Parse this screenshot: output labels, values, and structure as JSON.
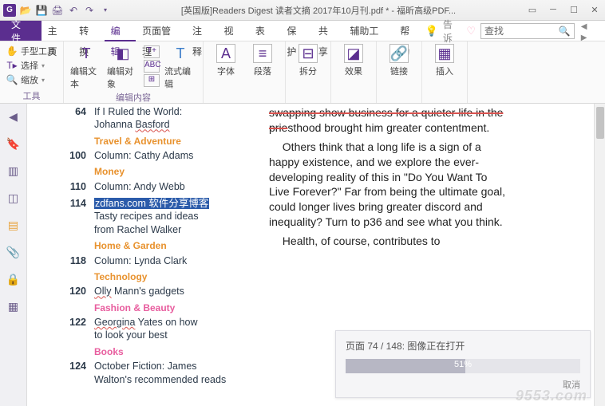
{
  "titlebar": {
    "title": "[英国版]Readers Digest 读者文摘 2017年10月刊.pdf * - 福昕高级PDF..."
  },
  "menu": {
    "file": "文件",
    "tabs": [
      "主页",
      "转换",
      "编辑",
      "页面管理",
      "注释",
      "视图",
      "表单",
      "保护",
      "共享",
      "辅助工具",
      "帮助"
    ],
    "active_index": 2,
    "tell": "告诉",
    "search_placeholder": "查找"
  },
  "ribbon": {
    "tools_group": "工具",
    "hand": "手型工具",
    "select": "选择",
    "zoom": "缩放",
    "edit_content_group": "编辑内容",
    "edit_text": "编辑文本",
    "edit_object": "编辑对象",
    "flow_edit": "流式编辑",
    "font_group": "字体",
    "font_label": "字体",
    "para_label": "段落",
    "split_label": "拆分",
    "effect_label": "效果",
    "link_label": "链接",
    "insert_label": "插入"
  },
  "toc": [
    {
      "pg": "64",
      "lines": [
        "If I Ruled the World:",
        "Johanna <wavy>Basford</wavy>"
      ]
    },
    {
      "section": "Travel & Adventure"
    },
    {
      "pg": "100",
      "lines": [
        "Column: Cathy Adams"
      ]
    },
    {
      "section": "Money"
    },
    {
      "pg": "110",
      "lines": [
        "Column: Andy Webb"
      ]
    },
    {
      "pg": "114",
      "lines": [
        "<hl>zdfans.com 软件分享博客</hl>",
        "Tasty recipes and ideas",
        "from Rachel Walker"
      ]
    },
    {
      "section": "Home & Garden"
    },
    {
      "pg": "118",
      "lines": [
        "Column: Lynda Clark"
      ]
    },
    {
      "section": "Technology"
    },
    {
      "pg": "120",
      "lines": [
        "<wavy>Olly</wavy> Mann's gadgets"
      ]
    },
    {
      "section_pink": "Fashion & Beauty"
    },
    {
      "pg": "122",
      "lines": [
        "<wavy>Georgina</wavy> Yates on how",
        "to look your best"
      ]
    },
    {
      "section_pink": "Books"
    },
    {
      "pg": "124",
      "lines": [
        "October Fiction: James",
        "Walton's recommended reads"
      ]
    }
  ],
  "article": {
    "p1a": "swapping show business for a quieter life in the prie",
    "p1b": "sthood brought him greater contentment.",
    "p2": "Others think that a long life is a sign of a happy existence, and we explore the ever-developing reality of this in \"Do You Want To Live Forever?\" Far from being the ultimate goal, could longer lives bring greater discord and inequality? Turn to p36 and see what you think.",
    "p3": "Health, of course, contributes to"
  },
  "progress": {
    "status": "页面 74 / 148: 图像正在打开",
    "percent": "51%",
    "cancel": "取消"
  },
  "watermark": "9553.com"
}
